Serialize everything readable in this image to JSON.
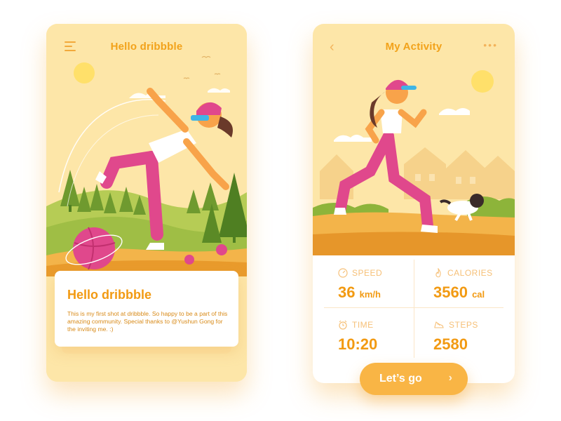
{
  "left": {
    "title": "Hello dribbble",
    "card_title": "Hello dribbble",
    "card_text": "This is my first shot at dribbble.  So happy to be a part of this amazing community. Special thanks to @Yushun Gong for the inviting me. :)"
  },
  "right": {
    "title": "My Activity",
    "stats": [
      {
        "label": "SPEED",
        "value": "36",
        "unit": "km/h",
        "icon": "speedometer-icon"
      },
      {
        "label": "CALORIES",
        "value": "3560",
        "unit": "cal",
        "icon": "flame-icon"
      },
      {
        "label": "TIME",
        "value": "10:20",
        "unit": "",
        "icon": "alarm-clock-icon"
      },
      {
        "label": "STEPS",
        "value": "2580",
        "unit": "",
        "icon": "shoe-icon"
      }
    ],
    "cta_label": "Let’s go"
  },
  "colors": {
    "accent": "#f29a12",
    "soft": "#fde6a8",
    "button": "#f9b545",
    "pink": "#e0488c"
  }
}
